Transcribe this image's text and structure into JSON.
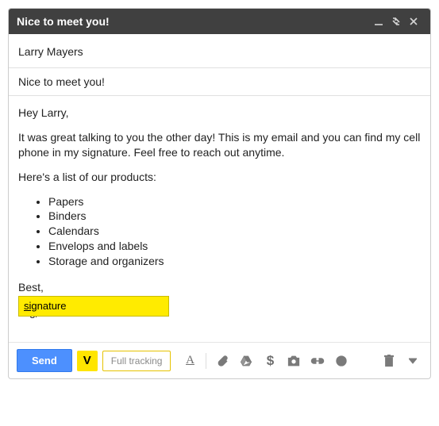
{
  "window": {
    "title": "Nice to meet you!"
  },
  "fields": {
    "to": "Larry Mayers",
    "subject": "Nice to meet you!"
  },
  "body": {
    "greeting": "Hey Larry,",
    "p1": "It was great talking to you the other day! This is my email and you can find my cell phone in my signature. Feel free to reach out anytime.",
    "p2": "Here's a list of our products:",
    "products": [
      "Papers",
      "Binders",
      "Calendars",
      "Envelops and labels",
      "Storage and organizers"
    ],
    "closing": "Best,",
    "typed": "/sig"
  },
  "autocomplete": {
    "prefix": "sig",
    "rest": "nature"
  },
  "toolbar": {
    "send": "Send",
    "vocus_label": "V",
    "tracking": "Full tracking",
    "dollar": "$"
  },
  "icons": {
    "minimize": "minimize-icon",
    "restore": "restore-icon",
    "close": "close-icon",
    "format": "format-icon",
    "attach": "attach-icon",
    "drive": "drive-icon",
    "money": "dollar-icon",
    "camera": "camera-icon",
    "link": "link-icon",
    "emoji": "emoji-icon",
    "trash": "trash-icon",
    "more": "more-icon"
  }
}
